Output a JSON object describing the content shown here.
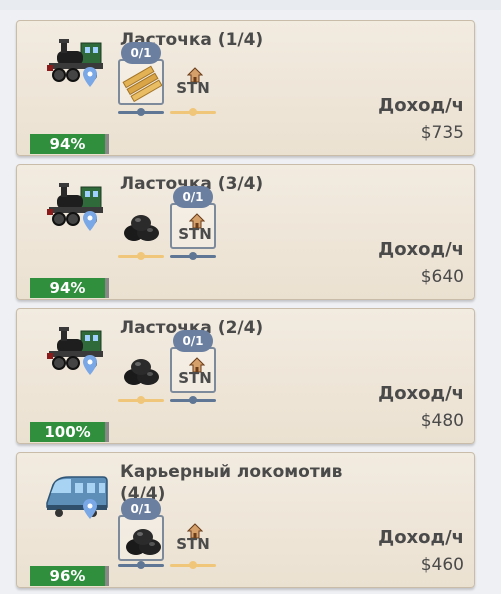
{
  "trains": [
    {
      "name": "Ласточка (1/4)",
      "locomotive_icon": "steam-locomotive-icon",
      "cargo_slots": [
        {
          "icon": "lumber-icon",
          "badge": "0/1",
          "selected": true
        },
        {
          "icon": "station-icon",
          "label": "STN",
          "badge": "",
          "selected": false
        }
      ],
      "income_label": "Доход/ч",
      "income_value": "$735",
      "fuel": "94%"
    },
    {
      "name": "Ласточка (3/4)",
      "locomotive_icon": "steam-locomotive-icon",
      "cargo_slots": [
        {
          "icon": "coal-icon",
          "badge": "",
          "selected": false
        },
        {
          "icon": "station-icon",
          "label": "STN",
          "badge": "0/1",
          "selected": true
        }
      ],
      "income_label": "Доход/ч",
      "income_value": "$640",
      "fuel": "94%"
    },
    {
      "name": "Ласточка (2/4)",
      "locomotive_icon": "steam-locomotive-icon",
      "cargo_slots": [
        {
          "icon": "coal-icon",
          "badge": "",
          "selected": false
        },
        {
          "icon": "station-icon",
          "label": "STN",
          "badge": "0/1",
          "selected": true
        }
      ],
      "income_label": "Доход/ч",
      "income_value": "$480",
      "fuel": "100%"
    },
    {
      "name": "Карьерный локомотив (4/4)",
      "locomotive_icon": "modern-train-icon",
      "cargo_slots": [
        {
          "icon": "coal-icon",
          "badge": "0/1",
          "selected": true
        },
        {
          "icon": "station-icon",
          "label": "STN",
          "badge": "",
          "selected": false
        }
      ],
      "income_label": "Доход/ч",
      "income_value": "$460",
      "fuel": "96%"
    }
  ],
  "colors": {
    "card_bg": "#efe6d8",
    "fuel_green": "#2f8f3c",
    "badge_blue": "#6b7fa0",
    "slot_line_blue": "#5f7794",
    "slot_line_gold": "#f0c77a"
  }
}
